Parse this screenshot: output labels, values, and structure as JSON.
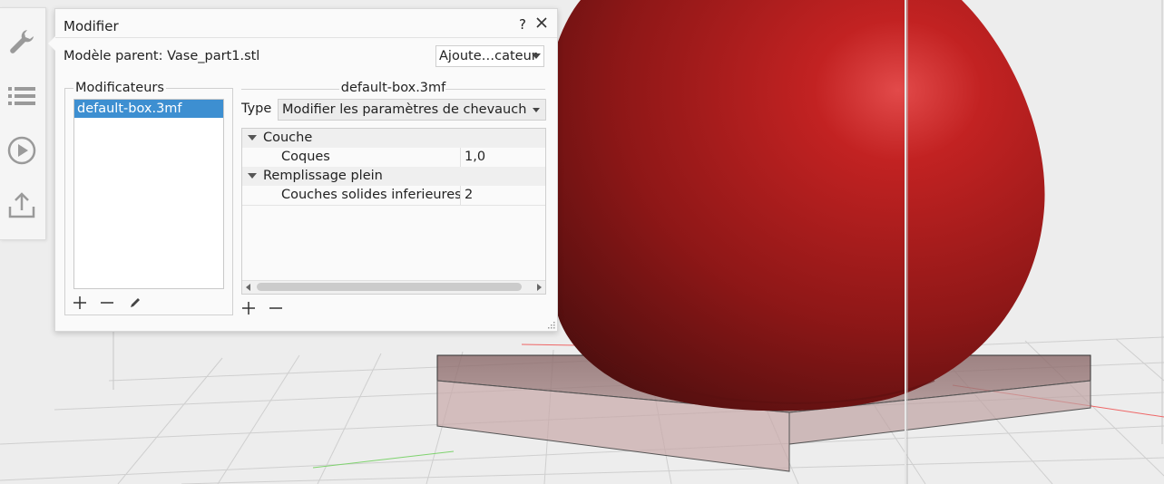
{
  "toolbar": {
    "items": [
      {
        "icon": "wrench-icon"
      },
      {
        "icon": "list-icon"
      },
      {
        "icon": "play-icon"
      },
      {
        "icon": "upload-icon"
      }
    ]
  },
  "dialog": {
    "title": "Modifier",
    "help_label": "?",
    "parent_label": "Modèle parent: Vase_part1.stl",
    "add_combo_value": "Ajoute…cateur",
    "group_title": "Modificateurs",
    "modifiers": [
      "default-box.3mf"
    ],
    "selected_name": "default-box.3mf",
    "type_label": "Type",
    "type_value": "Modifier les paramètres de chevauchement",
    "tree": [
      {
        "category": "Couche",
        "rows": [
          {
            "name": "Coques",
            "value": "1,0"
          }
        ]
      },
      {
        "category": "Remplissage plein",
        "rows": [
          {
            "name": "Couches solides inferieures",
            "value": "2"
          }
        ]
      }
    ]
  },
  "colors": {
    "accent": "#3d8fd1",
    "model_red": "#a81c1c",
    "toolbar_icon": "#9a9a9a"
  }
}
